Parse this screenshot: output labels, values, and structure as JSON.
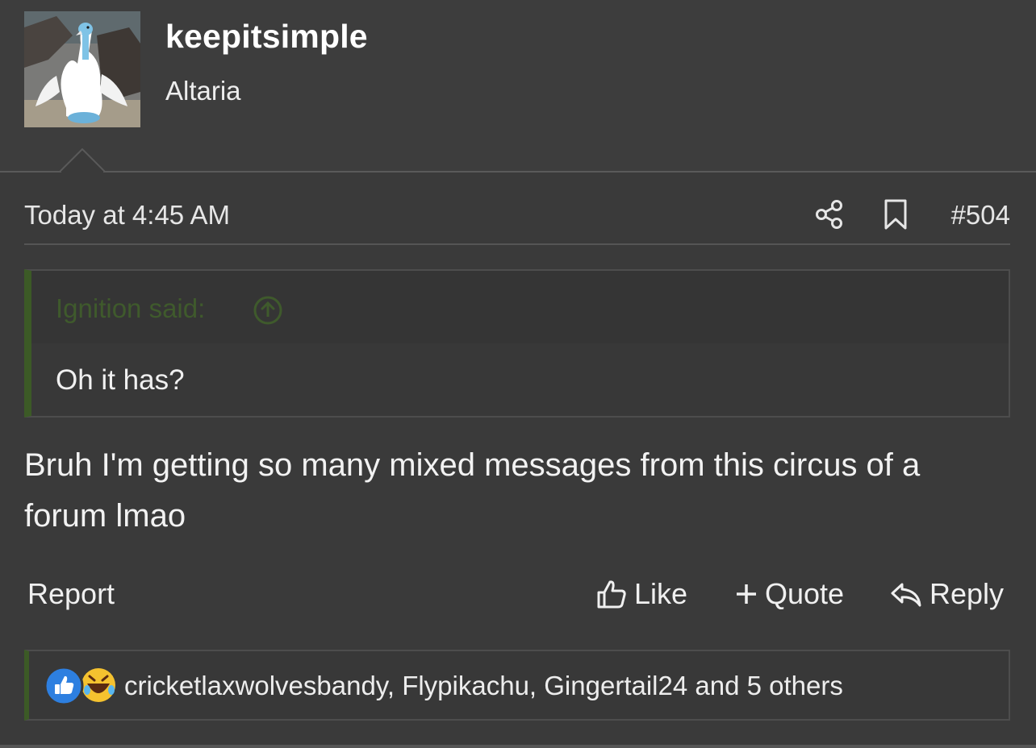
{
  "user": {
    "username": "keepitsimple",
    "user_title": "Altaria",
    "avatar_icon": "altaria-avatar"
  },
  "post": {
    "timestamp": "Today at 4:45 AM",
    "post_number": "#504",
    "share_icon": "share-icon",
    "bookmark_icon": "bookmark-icon"
  },
  "quote": {
    "author_label": "Ignition said:",
    "jump_icon": "arrow-up-circle-icon",
    "text": "Oh it has?"
  },
  "message": {
    "text": "Bruh I'm getting so many mixed messages from this circus of a forum lmao"
  },
  "actions": {
    "report": "Report",
    "like": "Like",
    "quote": "Quote",
    "reply": "Reply"
  },
  "reactions": {
    "icons": [
      "like-reaction-icon",
      "haha-reaction-icon"
    ],
    "summary": "cricketlaxwolvesbandy, Flypikachu, Gingertail24 and 5 others"
  },
  "colors": {
    "background": "#3a3a3a",
    "quote_accent": "#3c5a26",
    "quote_author": "#3f5a2c",
    "like_blue": "#2d7fe0",
    "haha_yellow": "#f5c22f"
  }
}
